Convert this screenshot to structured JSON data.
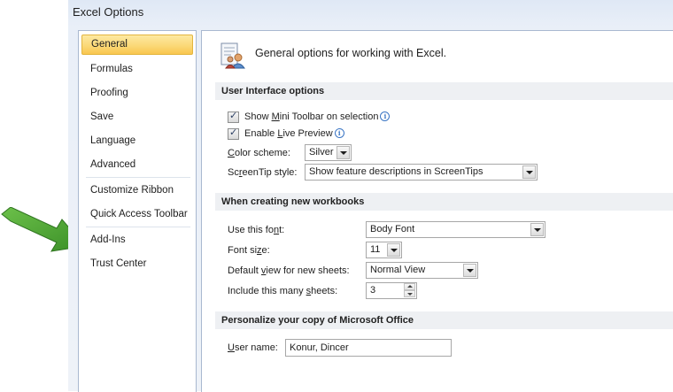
{
  "window": {
    "title": "Excel Options"
  },
  "nav": {
    "items": [
      {
        "label": "General",
        "selected": true
      },
      {
        "label": "Formulas"
      },
      {
        "label": "Proofing"
      },
      {
        "label": "Save"
      },
      {
        "label": "Language"
      },
      {
        "label": "Advanced"
      },
      {
        "label": "Customize Ribbon"
      },
      {
        "label": "Quick Access Toolbar"
      },
      {
        "label": "Add-Ins"
      },
      {
        "label": "Trust Center"
      }
    ]
  },
  "main": {
    "header": "General options for working with Excel.",
    "header_icon": "options-icon",
    "ui_section": {
      "title": "User Interface options",
      "mini_toolbar": {
        "pre": "Show ",
        "key": "M",
        "post": "ini Toolbar on selection",
        "checked": true
      },
      "live_preview": {
        "pre": "Enable ",
        "key": "L",
        "post": "ive Preview",
        "checked": true
      },
      "color_scheme": {
        "pre": "",
        "key": "C",
        "post": "olor scheme:",
        "value": "Silver"
      },
      "screentip": {
        "pre": "Sc",
        "key": "r",
        "post": "eenTip style:",
        "value": "Show feature descriptions in ScreenTips"
      }
    },
    "workbook_section": {
      "title": "When creating new workbooks",
      "font": {
        "pre": "Use this fo",
        "key": "n",
        "post": "t:",
        "value": "Body Font"
      },
      "font_size": {
        "pre": "Font si",
        "key": "z",
        "post": "e:",
        "value": "11"
      },
      "default_view": {
        "pre": "Default ",
        "key": "v",
        "post": "iew for new sheets:",
        "value": "Normal View"
      },
      "sheets": {
        "pre": "Include this many ",
        "key": "s",
        "post": "heets:",
        "value": "3"
      }
    },
    "personalize_section": {
      "title": "Personalize your copy of Microsoft Office",
      "username": {
        "pre": "",
        "key": "U",
        "post": "ser name:",
        "value": "Konur, Dincer"
      }
    }
  },
  "colors": {
    "selected_nav": "#f9c64f",
    "annotation_arrow": "#4aa234",
    "window_bg": "#e9eff8"
  }
}
